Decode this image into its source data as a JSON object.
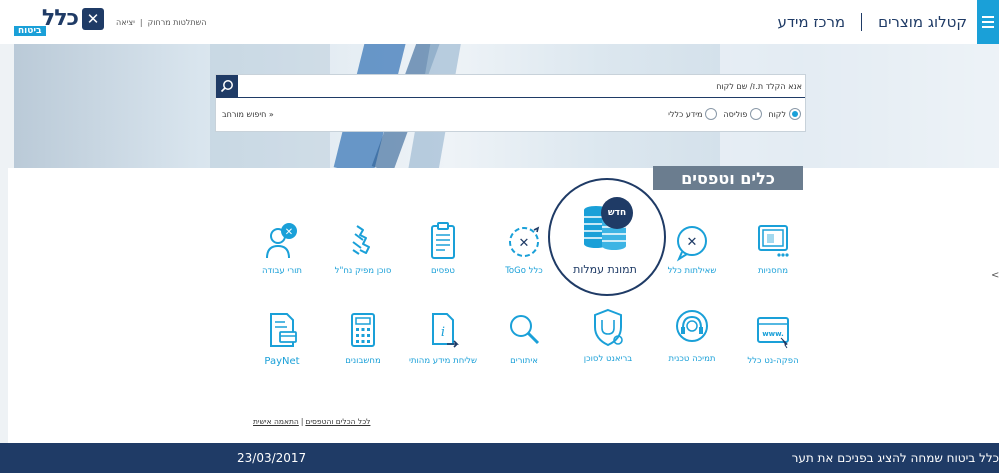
{
  "header": {
    "nav": [
      {
        "label": "קטלוג מוצרים"
      },
      {
        "label": "מרכז מידע"
      }
    ],
    "util_links": [
      "השתלטות מרחוק",
      "יציאה"
    ],
    "logo_text": "כלל",
    "logo_sub": "ביטוח"
  },
  "search": {
    "placeholder": "אנא הקלד ת.ז/ שם לקוח",
    "options": [
      {
        "label": "לקוח",
        "selected": true
      },
      {
        "label": "פוליסה",
        "selected": false
      },
      {
        "label": "מידע כללי",
        "selected": false
      }
    ],
    "advanced_label": "חיפוש מורחב »"
  },
  "tools": {
    "title": "כלים וטפסים",
    "featured": {
      "label": "תמונת עמלות",
      "badge": "חדש"
    },
    "row1": [
      {
        "label": "מחסניות",
        "icon": "monitor-icon"
      },
      {
        "label": "שאילתות כלל",
        "icon": "chat-bubble-icon"
      },
      {
        "label": "כלל ToGo",
        "icon": "togo-icon"
      },
      {
        "label": "טפסים",
        "icon": "clipboard-icon"
      },
      {
        "label": "סוכן מפיק נח\"ל",
        "icon": "handshake-icon"
      },
      {
        "label": "תורי עבודה",
        "icon": "person-icon"
      }
    ],
    "row2": [
      {
        "label": "הפקה-נט כלל",
        "icon": "www-icon"
      },
      {
        "label": "תמיכה טכנית",
        "icon": "headset-icon"
      },
      {
        "label": "בריאנט לסוכן",
        "icon": "shield-stethoscope-icon"
      },
      {
        "label": "איתורים",
        "icon": "magnifier-icon"
      },
      {
        "label": "שליחת מידע מהותי",
        "icon": "info-send-icon"
      },
      {
        "label": "מחשבונים",
        "icon": "calculator-icon"
      },
      {
        "label": "PayNet",
        "icon": "paynet-icon"
      }
    ],
    "bottom_links": [
      "לכל הכלים והטפסים",
      "התאמה אישית"
    ]
  },
  "ticker": {
    "text": "כלל ביטוח שמחה להציג בפניכם את תער",
    "date": "23/03/2017"
  },
  "colors": {
    "navy": "#1f3b66",
    "accent": "#1aa0d8",
    "title_bg": "#6b7d8f"
  }
}
